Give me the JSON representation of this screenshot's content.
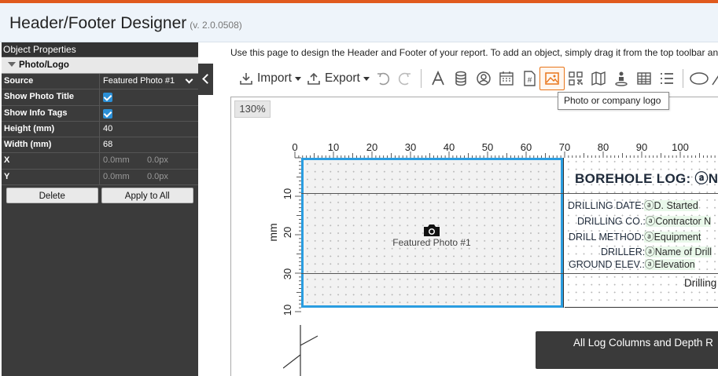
{
  "app": {
    "title": "Header/Footer Designer",
    "version": "(v. 2.0.0508)"
  },
  "panel": {
    "title": "Object Properties",
    "section": "Photo/Logo",
    "rows": {
      "source": {
        "label": "Source",
        "value": "Featured Photo #1"
      },
      "show_photo_title": {
        "label": "Show Photo Title",
        "checked": true
      },
      "show_info_tags": {
        "label": "Show Info Tags",
        "checked": true
      },
      "height": {
        "label": "Height (mm)",
        "value": "40"
      },
      "width": {
        "label": "Width (mm)",
        "value": "68"
      },
      "x": {
        "label": "X",
        "mm": "0.0mm",
        "px": "0.0px"
      },
      "y": {
        "label": "Y",
        "mm": "0.0mm",
        "px": "0.0px"
      }
    },
    "delete_label": "Delete",
    "apply_label": "Apply to All"
  },
  "instructions": "Use this page to design the Header and Footer of your report. To add an object, simply drag it from the top toolbar and drop it onto the design area.",
  "toolbar": {
    "import_label": "Import",
    "export_label": "Export",
    "icons": [
      "undo-icon",
      "redo-icon",
      "text-icon",
      "database-icon",
      "user-badge-icon",
      "calendar-icon",
      "page-number-icon",
      "photo-logo-icon",
      "qr-code-icon",
      "map-icon",
      "person-location-icon",
      "table-icon",
      "list-icon",
      "ellipse-icon"
    ],
    "tooltip": "Photo or company logo",
    "accent": "#e8751a"
  },
  "canvas": {
    "zoom": "130%",
    "ruler_x": [
      "0",
      "10",
      "20",
      "30",
      "40",
      "50",
      "60",
      "70",
      "80",
      "90",
      "100"
    ],
    "ruler_y": [
      "10",
      "20",
      "30",
      "10"
    ],
    "ruler_unit": "mm",
    "photo_label": "Featured Photo #1",
    "borehole_title": "BOREHOLE LOG: ⓐN",
    "info": [
      {
        "key": "DRILLING DATE:",
        "value": "ⓐD. Started"
      },
      {
        "key": "DRILLING CO.:",
        "value": "ⓐContractor N"
      },
      {
        "key": "DRILL METHOD:",
        "value": "ⓐEquipment"
      },
      {
        "key": "DRILLER:",
        "value": "ⓐName of Drill"
      },
      {
        "key": "GROUND ELEV.:",
        "value": "ⓐElevation"
      }
    ],
    "drilling_text": "Drilling",
    "all_log_label": "All Log Columns and Depth R"
  },
  "colors": {
    "topline": "#e05a1e",
    "panel_bg": "#3b3b3b",
    "selection": "#2a9de0"
  }
}
